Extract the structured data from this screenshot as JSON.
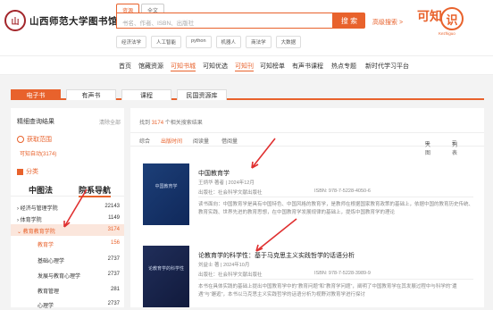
{
  "header": {
    "seal_text": "山",
    "logo_text": "山西师范大学图书馆",
    "search_tabs": [
      "资源",
      "全文"
    ],
    "search_placeholder": "书名、作者、ISBN、出版社",
    "search_button": "搜 索",
    "advanced_search": "高级搜索 >",
    "brand": "可知",
    "brand_glyph": "识",
    "brand_sub": "Kezhiguo",
    "hot_tags": [
      "经济法学",
      "人工智能",
      "python",
      "机器人",
      "商法学",
      "大数据"
    ]
  },
  "nav": {
    "items": [
      "首页",
      "馆藏资源",
      "可知书城",
      "可知优选",
      "可知刊",
      "可知榜单",
      "有声书课程",
      "热点专题",
      "新时代学习平台"
    ]
  },
  "tabs": [
    "电子书",
    "有声书",
    "课程",
    "民国资源库"
  ],
  "sidebar": {
    "title": "精细查询结果",
    "clear": "清除全部",
    "scope_title": "获取范围",
    "scope_item": "可知自动(3174)",
    "category_title": "分类",
    "class_tabs": [
      "中图法",
      "院系导航"
    ],
    "rows": [
      {
        "label": "经济与管理学院",
        "count": "22143"
      },
      {
        "label": "体育学院",
        "count": "1149"
      },
      {
        "label": "教育教育学院",
        "count": "3174"
      },
      {
        "label": "教育学",
        "count": "156"
      },
      {
        "label": "基础心理学",
        "count": "2737"
      },
      {
        "label": "发展与教育心理学",
        "count": "2737"
      },
      {
        "label": "教育管理",
        "count": "281"
      },
      {
        "label": "心理学",
        "count": "2737"
      }
    ]
  },
  "results": {
    "found_prefix": "找到",
    "found_count": "3174",
    "found_suffix": "个相关搜索结果",
    "sort": [
      "综合",
      "出版时间",
      "阅读量",
      "借阅量"
    ],
    "view": [
      "大图",
      "列表"
    ],
    "books": [
      {
        "title": "中国教育学",
        "author": "王炳华 著者 | 2024年12月",
        "publisher": "出版社：社会科学文献出版社",
        "isbn": "ISBN: 978-7-5228-4050-6",
        "desc": "读书面向：中国教育学是具有中国特色、中国风格的教育学，是教师在根据国家教育政策的基础上，依据中国的教育历史传统、教育实践、世界先进的教育思想，在中国教育学发展规律的基础上，提炼中国教育学的理论",
        "cover": "中国教育学"
      },
      {
        "title": "论教育学的科学性：基于马克思主义实践哲学的话语分析",
        "author": "刘益士 著 | 2024年10月",
        "publisher": "出版社：社会科学文献出版社",
        "isbn": "ISBN: 978-7-5228-3989-9",
        "desc": "本书在具体实践的基础上提出中国教育学中的“教育问题”和“教育学问题”，阐明了中国教育学在其发展过程中与科学的“遭遇”与“邂逅”，本书以马克思主义实践哲学的话语分析为视野对教育学进行探讨",
        "cover": "论教育学的科学性"
      }
    ]
  },
  "colors": {
    "accent": "#e8622c",
    "annotation": "#e03030"
  }
}
